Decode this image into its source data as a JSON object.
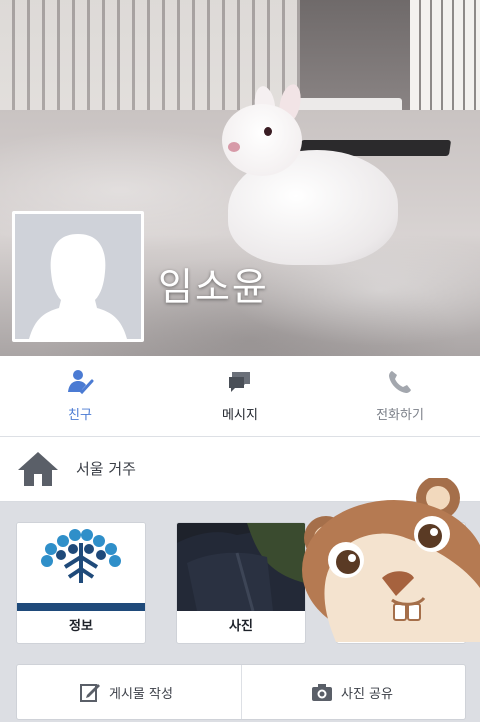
{
  "profile": {
    "name": "임소윤"
  },
  "actions": {
    "friends": {
      "label": "친구",
      "icon": "friend-check-icon",
      "color": "#4b7bd3"
    },
    "message": {
      "label": "메시지",
      "icon": "message-icon"
    },
    "call": {
      "label": "전화하기",
      "icon": "phone-icon"
    }
  },
  "location": {
    "text": "서울 거주",
    "icon": "home-icon"
  },
  "cards": [
    {
      "label": "정보"
    },
    {
      "label": "사진"
    },
    {
      "label": ""
    }
  ],
  "bottom_bar": {
    "write_post": {
      "label": "게시물 작성",
      "icon": "pencil-icon"
    },
    "share_photo": {
      "label": "사진 공유",
      "icon": "camera-icon"
    }
  },
  "colors": {
    "accent": "#4b7bd3",
    "text_dark": "#1d2129",
    "background": "#dcdee3"
  }
}
